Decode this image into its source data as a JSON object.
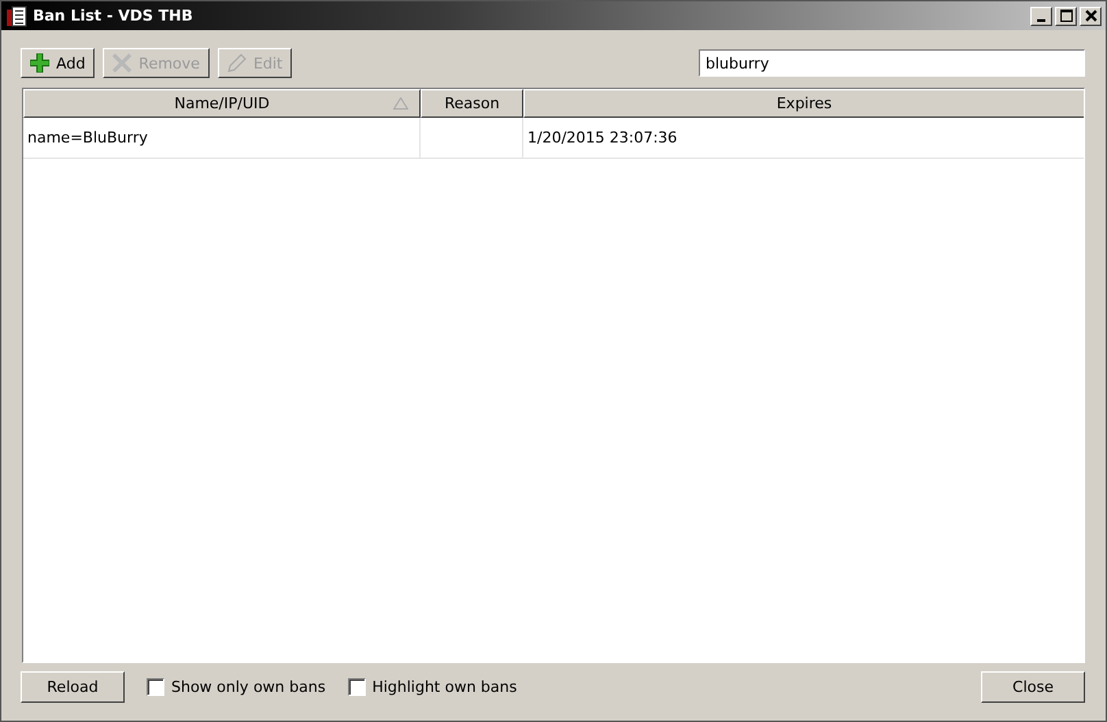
{
  "window": {
    "title": "Ban List - VDS THB"
  },
  "toolbar": [
    {
      "kind": "add",
      "label": "Add",
      "disabled": false
    },
    {
      "kind": "remove",
      "label": "Remove",
      "disabled": true
    },
    {
      "kind": "edit",
      "label": "Edit",
      "disabled": true
    }
  ],
  "search": {
    "value": "bluburry"
  },
  "table": {
    "columns": [
      {
        "label": "Name/IP/UID",
        "sorted": true
      },
      {
        "label": "Reason",
        "sorted": false
      },
      {
        "label": "Expires",
        "sorted": false
      }
    ],
    "rows": [
      [
        "name=BluBurry",
        "",
        "1/20/2015 23:07:36"
      ]
    ]
  },
  "footer": {
    "reload": "Reload",
    "checkboxes": [
      {
        "label": "Show only own bans",
        "checked": false
      },
      {
        "label": "Highlight own bans",
        "checked": false
      }
    ],
    "close": "Close"
  }
}
